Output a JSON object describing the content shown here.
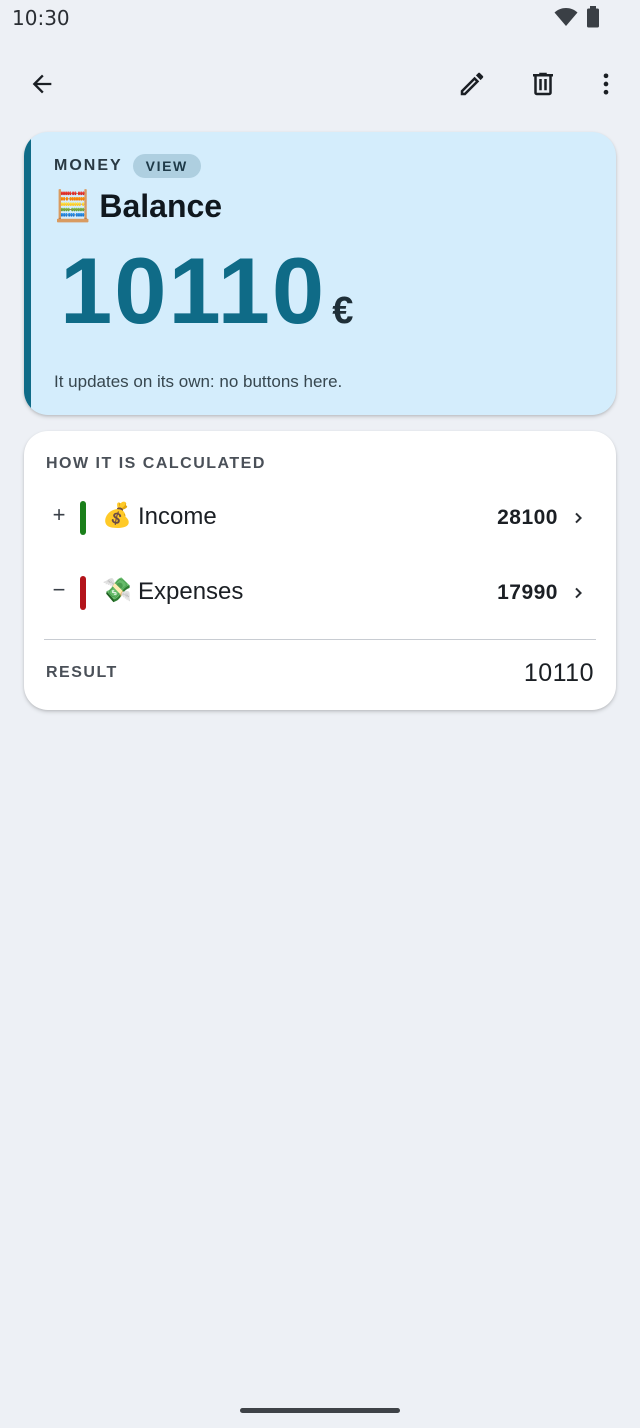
{
  "status_bar": {
    "time": "10:30",
    "icons": [
      "wifi-icon",
      "battery-icon"
    ]
  },
  "app_bar": {
    "back_icon": "arrow-back-icon",
    "actions": [
      "edit-pencil-icon",
      "delete-trash-icon",
      "more-vert-icon"
    ]
  },
  "balance_card": {
    "kicker": "MONEY",
    "pill": "VIEW",
    "emoji": "🧮",
    "title": "Balance",
    "amount": "10110",
    "currency": "€",
    "note": "It updates on its own: no buttons here.",
    "accent_color": "#0f6b87",
    "background_color": "#d4edfc"
  },
  "calculation_card": {
    "header": "HOW IT IS CALCULATED",
    "rows": [
      {
        "sign": "+",
        "bar_color": "#1a7f1a",
        "emoji": "💰",
        "label": "Income",
        "value": "28100"
      },
      {
        "sign": "−",
        "bar_color": "#b3141b",
        "emoji": "💸",
        "label": "Expenses",
        "value": "17990"
      }
    ],
    "result_label": "RESULT",
    "result_value": "10110"
  }
}
